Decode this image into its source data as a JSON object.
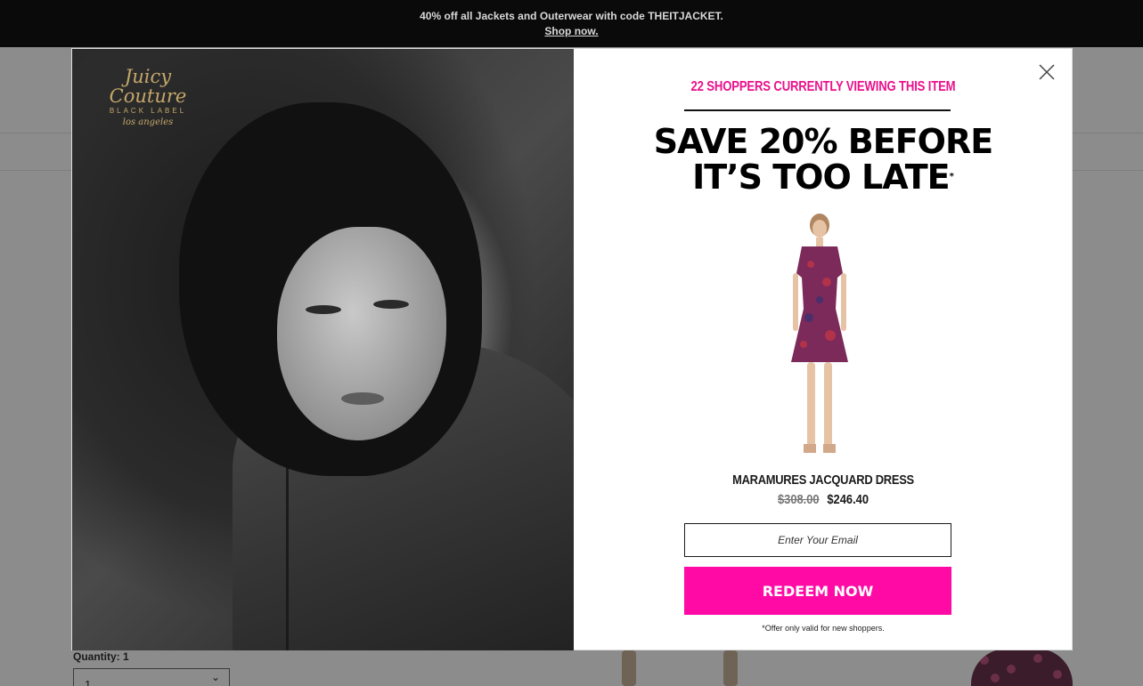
{
  "promo": {
    "text": "40% off all Jackets and Outerwear with code THEITJACKET.",
    "link": "Shop now."
  },
  "page": {
    "quantity_label": "Quantity: 1",
    "quantity_value": "1"
  },
  "modal": {
    "brand_logo": {
      "main": "Juicy Couture",
      "sub": "BLACK LABEL",
      "city": "los angeles"
    },
    "viewers_text": "22 SHOPPERS CURRENTLY VIEWING THIS ITEM",
    "headline_line1": "SAVE 20% BEFORE",
    "headline_line2": "IT’S TOO LATE",
    "headline_mark": "*",
    "product": {
      "name": "MARAMURES JACQUARD DRESS",
      "price_original": "$308.00",
      "price_sale": "$246.40"
    },
    "email_placeholder": "Enter Your Email",
    "cta_label": "REDEEM NOW",
    "disclaimer": "*Offer only valid for new shoppers.",
    "close_icon": "close-icon"
  },
  "colors": {
    "accent_pink": "#ff0aa4",
    "viewers_pink": "#ea118c",
    "promo_bg": "#0a0a0a",
    "logo_gold": "#c5a86a"
  }
}
